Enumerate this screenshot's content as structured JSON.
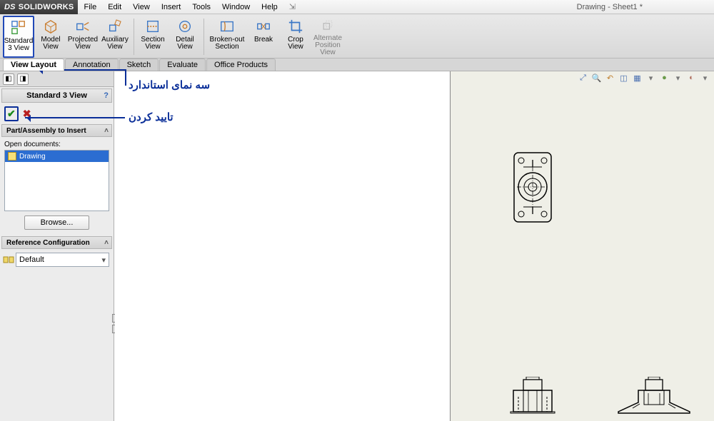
{
  "app": {
    "brand": "SOLIDWORKS",
    "doc_title": "Drawing - Sheet1 *"
  },
  "menu": {
    "file": "File",
    "edit": "Edit",
    "view": "View",
    "insert": "Insert",
    "tools": "Tools",
    "window": "Window",
    "help": "Help"
  },
  "ribbon": {
    "std3": {
      "l1": "Standard",
      "l2": "3 View"
    },
    "model": {
      "l1": "Model",
      "l2": "View"
    },
    "proj": {
      "l1": "Projected",
      "l2": "View"
    },
    "aux": {
      "l1": "Auxiliary",
      "l2": "View"
    },
    "sec": {
      "l1": "Section",
      "l2": "View"
    },
    "det": {
      "l1": "Detail",
      "l2": "View"
    },
    "brk": {
      "l1": "Broken-out",
      "l2": "Section"
    },
    "break": {
      "l1": "Break",
      "l2": ""
    },
    "crop": {
      "l1": "Crop",
      "l2": "View"
    },
    "alt": {
      "l1": "Alternate",
      "l2": "Position",
      "l3": "View"
    }
  },
  "tabs": {
    "viewlayout": "View Layout",
    "annotation": "Annotation",
    "sketch": "Sketch",
    "evaluate": "Evaluate",
    "office": "Office Products"
  },
  "panel": {
    "title": "Standard 3 View",
    "sec1": "Part/Assembly to Insert",
    "open_docs": "Open documents:",
    "sel_item": "Drawing",
    "browse": "Browse...",
    "sec2": "Reference Configuration",
    "config": "Default"
  },
  "annot": {
    "t1": "سه نمای استاندارد",
    "t2": "تایید کردن"
  }
}
